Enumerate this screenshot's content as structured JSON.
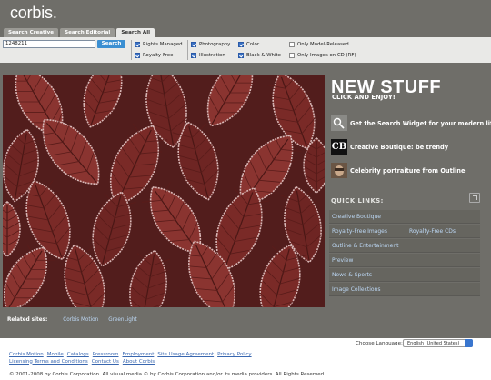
{
  "app": {
    "logo": "corbis."
  },
  "tabs": [
    {
      "label": "Search Creative"
    },
    {
      "label": "Search Editorial"
    },
    {
      "label": "Search All"
    }
  ],
  "search": {
    "value": "1248211",
    "button": "Search"
  },
  "filters": {
    "col1": [
      {
        "label": "Rights Managed",
        "checked": true
      },
      {
        "label": "Royalty-Free",
        "checked": true
      }
    ],
    "col2": [
      {
        "label": "Photography",
        "checked": true
      },
      {
        "label": "Illustration",
        "checked": true
      }
    ],
    "col3": [
      {
        "label": "Color",
        "checked": true
      },
      {
        "label": "Black & White",
        "checked": true
      }
    ],
    "col4": [
      {
        "label": "Only Model-Released",
        "checked": false
      },
      {
        "label": "Only Images on CD (RF)",
        "checked": false
      }
    ]
  },
  "new_stuff": {
    "title": "NEW STUFF",
    "subtitle": "CLICK AND ENJOY!",
    "items": [
      {
        "label": "Get the Search Widget for your modern life",
        "icon": "search-widget-icon"
      },
      {
        "label": "Creative Boutique: be trendy",
        "icon": "cb-logo-icon",
        "text": "CB"
      },
      {
        "label": "Celebrity portraiture from Outline",
        "icon": "celebrity-portrait-icon"
      }
    ]
  },
  "quick_links": {
    "title": "QUICK LINKS:",
    "rows": [
      {
        "labels": [
          "Creative Boutique"
        ]
      },
      {
        "labels": [
          "Royalty-Free Images",
          "Royalty-Free CDs"
        ]
      },
      {
        "labels": [
          "Outline & Entertainment"
        ]
      },
      {
        "labels": [
          "Preview"
        ]
      },
      {
        "labels": [
          "News & Sports"
        ]
      },
      {
        "labels": [
          "Image Collections"
        ]
      }
    ]
  },
  "related": {
    "label": "Related sites:",
    "links": [
      "Corbis Motion",
      "GreenLight"
    ]
  },
  "footer": {
    "links": [
      "Corbis Motion",
      "Mobile",
      "Catalogs",
      "Pressroom",
      "Employment",
      "Site Usage Agreement",
      "Privacy Policy",
      "Licensing Terms and Conditions",
      "Contact Us",
      "About Corbis"
    ],
    "language_label": "Choose Language:",
    "language_value": "English (United States)",
    "copyright": "© 2001-2008 by Corbis Corporation. All visual media © by Corbis Corporation and/or its media providers. All Rights Reserved."
  },
  "colors": {
    "header_bg": "#6f6e69",
    "link_blue": "#bcd7f4",
    "search_button": "#3b8fd2",
    "leaf": "#7e2e2a"
  }
}
